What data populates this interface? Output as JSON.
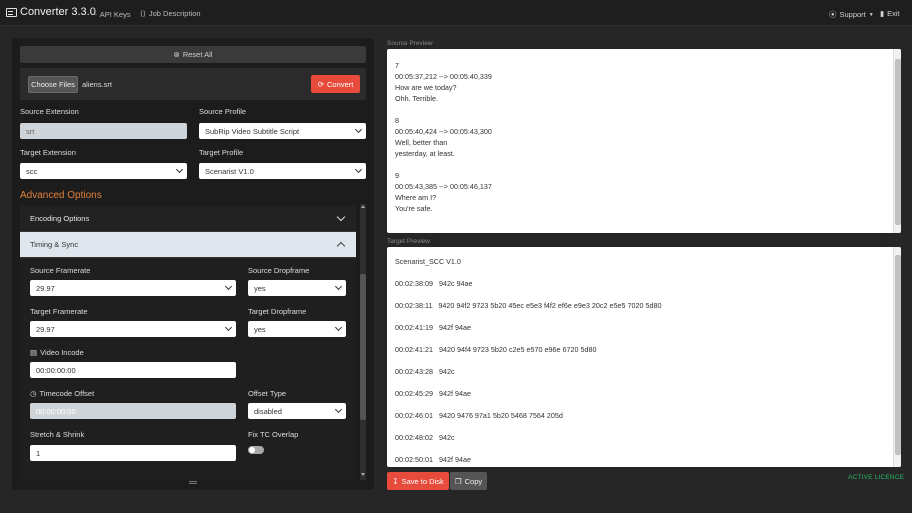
{
  "app": {
    "title": "Converter 3.3.0",
    "nav": {
      "api_keys": "API Keys",
      "job_description": "Job Description",
      "support": "Support",
      "exit": "Exit"
    }
  },
  "left": {
    "reset_label": "Reset All",
    "choose_files": "Choose Files",
    "file_name": "aliens.srt",
    "convert_label": "Convert",
    "source_extension": {
      "label": "Source Extension",
      "value": "srt"
    },
    "source_profile": {
      "label": "Source Profile",
      "value": "SubRip Video Subtitle Script"
    },
    "target_extension": {
      "label": "Target Extension",
      "value": "scc"
    },
    "target_profile": {
      "label": "Target Profile",
      "value": "Scenarist V1.0"
    },
    "advanced_title": "Advanced Options",
    "encoding_options": "Encoding Options",
    "timing_sync": "Timing & Sync",
    "fields": {
      "source_framerate": {
        "label": "Source Framerate",
        "value": "29.97"
      },
      "source_dropframe": {
        "label": "Source Dropframe",
        "value": "yes"
      },
      "target_framerate": {
        "label": "Target Framerate",
        "value": "29.97"
      },
      "target_dropframe": {
        "label": "Target Dropframe",
        "value": "yes"
      },
      "video_incode": {
        "label": "Video Incode",
        "value": "00:00:00:00"
      },
      "timecode_offset": {
        "label": "Timecode Offset",
        "value": "00:00:00:00"
      },
      "offset_type": {
        "label": "Offset Type",
        "value": "disabled"
      },
      "stretch_shrink": {
        "label": "Stretch & Shrink",
        "value": "1"
      },
      "fix_tc_overlap": {
        "label": "Fix TC Overlap",
        "enabled": false
      }
    }
  },
  "right": {
    "source_preview_label": "Source Preview",
    "source_lines": [
      "7",
      "00:05:37,212 --> 00:05:40,339",
      "How are we today?",
      "Ohh. Terrible.",
      "",
      "8",
      "00:05:40,424 --> 00:05:43,300",
      "Well, better than",
      "yesterday, at least.",
      "",
      "9",
      "00:05:43,385 --> 00:05:46,137",
      "Where am I?",
      "You're safe."
    ],
    "target_preview_label": "Target Preview",
    "target_lines": [
      "Scenarist_SCC V1.0",
      "",
      "00:02:38:09   942c 94ae",
      "",
      "00:02:38:11   9420 94f2 9723 5b20 45ec e5e3 f4f2 ef6e e9e3 20c2 e5e5 7020 5d80",
      "",
      "00:02:41:19   942f 94ae",
      "",
      "00:02:41:21   9420 94f4 9723 5b20 c2e5 e570 e96e 6720 5d80",
      "",
      "00:02:43:28   942c",
      "",
      "00:02:45:29   942f 94ae",
      "",
      "00:02:46:01   9420 9476 97a1 5b20 5468 7564 205d",
      "",
      "00:02:48:02   942c",
      "",
      "00:02:50:01   942f 94ae"
    ],
    "save_label": "Save to Disk",
    "copy_label": "Copy",
    "licence": "ACTIVE LICENCE"
  },
  "colors": {
    "accent_red": "#e64b3b",
    "advanced_orange": "#e0803a",
    "licence_green": "#29b765"
  }
}
